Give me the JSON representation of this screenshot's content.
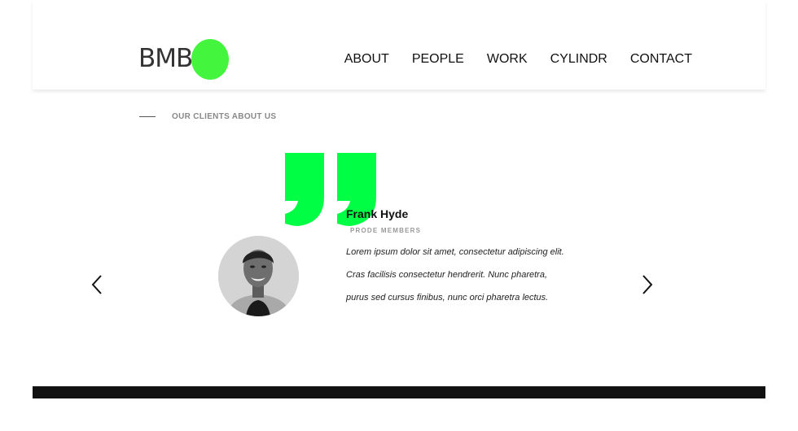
{
  "brand": {
    "logo_text": "BMB",
    "accent_color": "#43f53c"
  },
  "nav": {
    "items": [
      {
        "label": "ABOUT"
      },
      {
        "label": "PEOPLE"
      },
      {
        "label": "WORK"
      },
      {
        "label": "CYLINDR"
      },
      {
        "label": "CONTACT"
      }
    ]
  },
  "section": {
    "label": "OUR CLIENTS ABOUT US"
  },
  "testimonial": {
    "name": "Frank Hyde",
    "role": "PRODE MEMBERS",
    "lines": [
      "Lorem ipsum dolor sit amet, consectetur adipiscing elit.",
      "Cras facilisis consectetur hendrerit. Nunc pharetra,",
      "purus sed cursus finibus, nunc orci pharetra lectus."
    ],
    "quote_color": "#00ff44"
  },
  "controls": {
    "prev_icon": "chevron-left-icon",
    "next_icon": "chevron-right-icon"
  },
  "footer": {
    "bar_color": "#111111"
  }
}
